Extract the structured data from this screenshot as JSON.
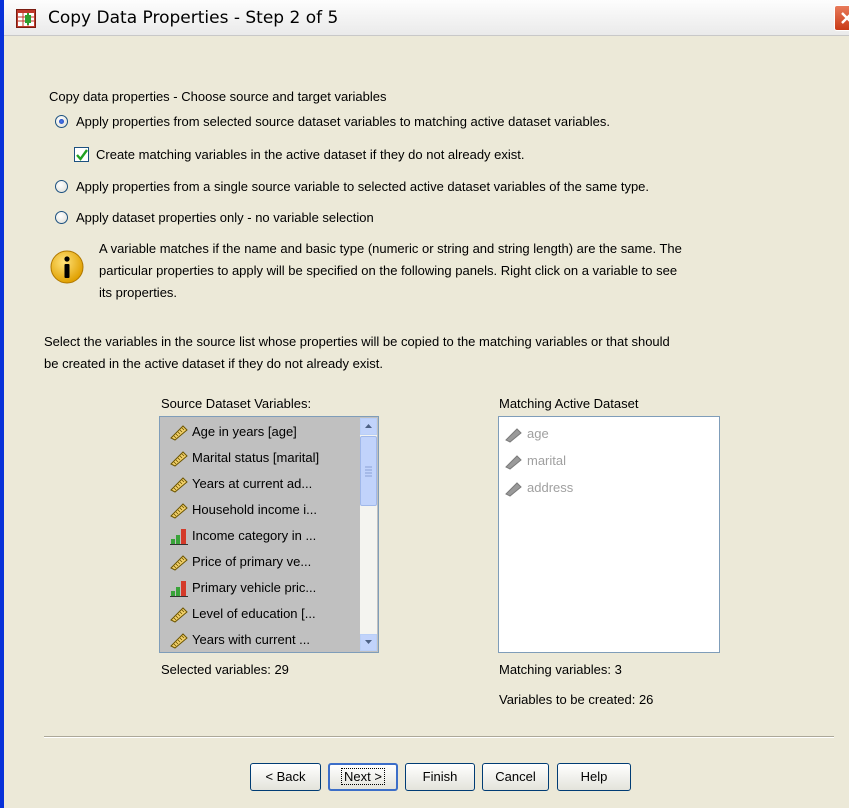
{
  "window": {
    "title": "Copy Data Properties - Step 2 of 5"
  },
  "intro_text": "Copy data properties - Choose source and target variables",
  "options": {
    "opt1_label": "Apply properties from selected source dataset variables to matching active dataset variables.",
    "opt1_checked": true,
    "create_matching_label": "Create matching variables in the active dataset if they do not already  exist.",
    "create_matching_checked": true,
    "opt2_label": "Apply properties from a single source variable to selected active dataset variables of the same type.",
    "opt3_label": "Apply dataset properties only -  no variable selection"
  },
  "info": {
    "line1": "A variable matches if the name and basic type (numeric or string and string length) are the same. The",
    "line2": "particular properties to apply will be specified on the following panels. Right click on a variable to see",
    "line3": "its properties."
  },
  "instructions": {
    "line1": "Select the variables in the source list whose properties will be copied to the matching variables or that should",
    "line2": "be created in the active dataset if they do not already exist."
  },
  "source": {
    "header": "Source Dataset Variables:",
    "items": [
      {
        "label": "Age in years [age]",
        "icon": "scale-ruler-icon"
      },
      {
        "label": "Marital status [marital]",
        "icon": "scale-ruler-icon"
      },
      {
        "label": "Years at current ad...",
        "icon": "scale-ruler-icon"
      },
      {
        "label": "Household income i...",
        "icon": "scale-ruler-icon"
      },
      {
        "label": "Income category in ...",
        "icon": "ordinal-bars-icon"
      },
      {
        "label": "Price of primary ve...",
        "icon": "scale-ruler-icon"
      },
      {
        "label": "Primary vehicle pric...",
        "icon": "ordinal-bars-icon"
      },
      {
        "label": "Level of education [...",
        "icon": "scale-ruler-icon"
      },
      {
        "label": "Years with current ...",
        "icon": "scale-ruler-icon"
      }
    ],
    "selected_count_label": "Selected variables: 29"
  },
  "matching": {
    "header": "Matching Active Dataset",
    "items": [
      {
        "label": "age"
      },
      {
        "label": "marital"
      },
      {
        "label": "address"
      }
    ],
    "matching_count_label": "Matching variables: 3",
    "to_create_label": "Variables to be created: 26"
  },
  "buttons": {
    "back": "< Back",
    "next": "Next >",
    "finish": "Finish",
    "cancel": "Cancel",
    "help": "Help"
  },
  "colors": {
    "title_border": "#0831d9",
    "dialog_bg": "#ece9d8",
    "close_red": "#c93a16"
  }
}
